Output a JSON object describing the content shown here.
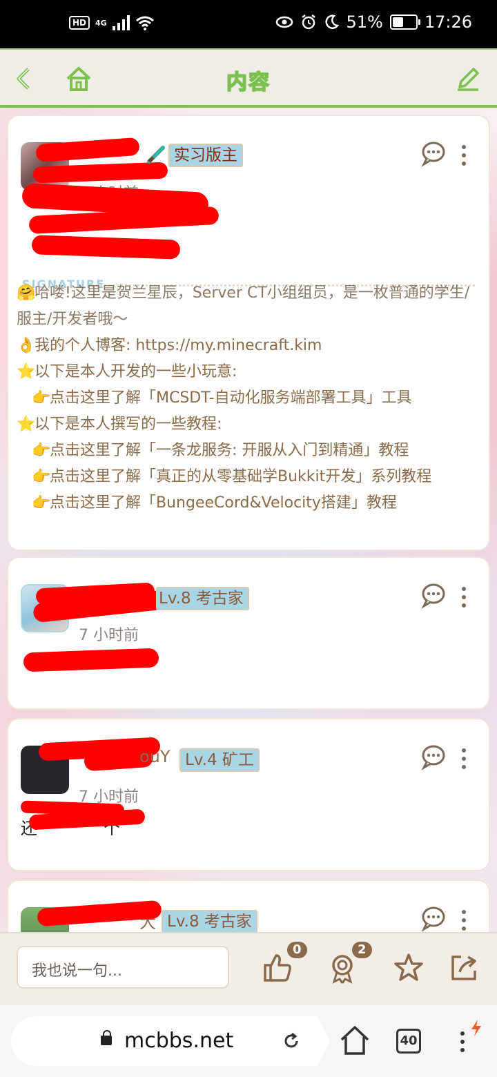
{
  "status_bar": {
    "hd": "HD",
    "network": "4G",
    "battery_percent": "51%",
    "battery_level": 0.51,
    "time": "17:26"
  },
  "header": {
    "title": "内容",
    "back_icon": "back-chevron-icon",
    "home_icon": "home-icon",
    "edit_icon": "edit-pencil-icon"
  },
  "posts": [
    {
      "badge": "实习版主",
      "time": "7 小时前",
      "signature_banner": "SIGNATURE",
      "signature": {
        "intro": "哈喽!这里是贺兰星辰，Server CT小组组员，是一枚普通的学生/服主/开发者哦～",
        "blog": "我的个人博客: https://my.minecraft.kim",
        "dev_heading": "以下是本人开发的一些小玩意:",
        "dev_item": "点击这里了解「MCSDT-自动化服务端部署工具」工具",
        "tut_heading": "以下是本人撰写的一些教程:",
        "tut_items": [
          "点击这里了解「一条龙服务: 开服从入门到精通」教程",
          "点击这里了解「真正的从零基础学Bukkit开发」系列教程",
          "点击这里了解「BungeeCord&Velocity搭建」教程"
        ]
      }
    },
    {
      "badge": "Lv.8 考古家",
      "time": "7 小时前"
    },
    {
      "name_tail": "ouY",
      "badge": "Lv.4 矿工",
      "time": "7 小时前",
      "body_lead": "还",
      "body_tail": "个"
    },
    {
      "name_tail": "大",
      "badge": "Lv.8 考古家"
    }
  ],
  "bottom_bar": {
    "comment_placeholder": "我也说一句...",
    "like_count": "0",
    "reward_count": "2"
  },
  "browser": {
    "url": "mcbbs.net",
    "tab_count": "40"
  }
}
